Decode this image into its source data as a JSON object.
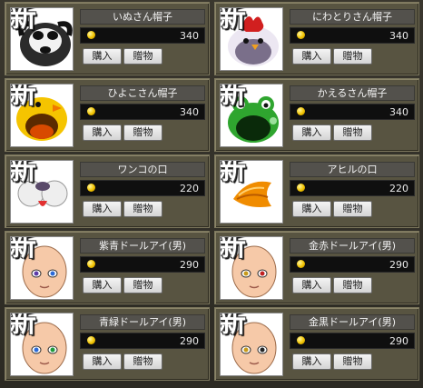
{
  "items": [
    {
      "name": "いぬさん帽子",
      "price": "340",
      "new_label": "新",
      "buy_label": "購入",
      "gift_label": "贈物",
      "icon": "dog-hat"
    },
    {
      "name": "にわとりさん帽子",
      "price": "340",
      "new_label": "新",
      "buy_label": "購入",
      "gift_label": "贈物",
      "icon": "chicken-hat"
    },
    {
      "name": "ひよこさん帽子",
      "price": "340",
      "new_label": "新",
      "buy_label": "購入",
      "gift_label": "贈物",
      "icon": "chick-hat"
    },
    {
      "name": "かえるさん帽子",
      "price": "340",
      "new_label": "新",
      "buy_label": "購入",
      "gift_label": "贈物",
      "icon": "frog-hat"
    },
    {
      "name": "ワンコの口",
      "price": "220",
      "new_label": "新",
      "buy_label": "購入",
      "gift_label": "贈物",
      "icon": "dog-mouth"
    },
    {
      "name": "アヒルの口",
      "price": "220",
      "new_label": "新",
      "buy_label": "購入",
      "gift_label": "贈物",
      "icon": "duck-mouth"
    },
    {
      "name": "紫青ドールアイ(男)",
      "price": "290",
      "new_label": "新",
      "buy_label": "購入",
      "gift_label": "贈物",
      "icon": "doll-eye-face"
    },
    {
      "name": "金赤ドールアイ(男)",
      "price": "290",
      "new_label": "新",
      "buy_label": "購入",
      "gift_label": "贈物",
      "icon": "doll-eye-face"
    },
    {
      "name": "青緑ドールアイ(男)",
      "price": "290",
      "new_label": "新",
      "buy_label": "購入",
      "gift_label": "贈物",
      "icon": "doll-eye-face"
    },
    {
      "name": "金黒ドールアイ(男)",
      "price": "290",
      "new_label": "新",
      "buy_label": "購入",
      "gift_label": "贈物",
      "icon": "doll-eye-face"
    }
  ],
  "colors": {
    "card_bg": "#585441",
    "name_bg": "#53514c",
    "price_bg": "#0f0f0f",
    "coin": "#f2c300"
  }
}
